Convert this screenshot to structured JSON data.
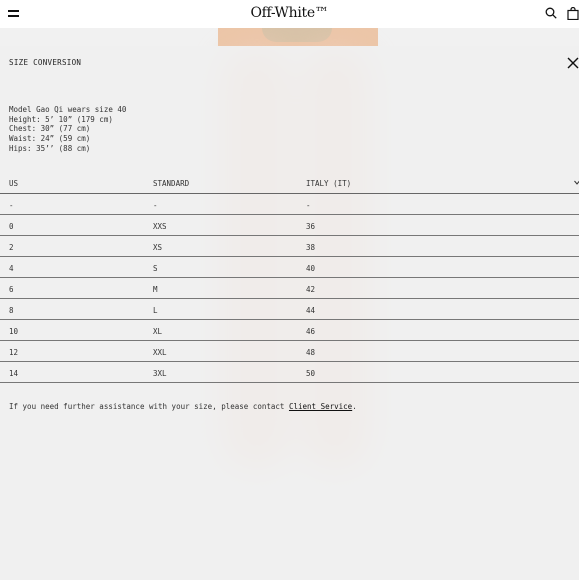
{
  "header": {
    "logo": "Off-White™",
    "menu_icon": "hamburger-menu-icon",
    "search_icon": "search-icon",
    "bag_icon": "shopping-bag-icon"
  },
  "panel": {
    "title": "SIZE CONVERSION",
    "close_icon": "close-icon",
    "model_info": [
      "Model Gao Qi wears size 40",
      "Height: 5’ 10” (179 cm)",
      "Chest: 30” (77 cm)",
      "Waist: 24” (59 cm)",
      "Hips: 35’’ (88 cm)"
    ],
    "table": {
      "headers": [
        "US",
        "STANDARD",
        "ITALY (IT)"
      ],
      "rows": [
        [
          "-",
          "-",
          "-"
        ],
        [
          "0",
          "XXS",
          "36"
        ],
        [
          "2",
          "XS",
          "38"
        ],
        [
          "4",
          "S",
          "40"
        ],
        [
          "6",
          "M",
          "42"
        ],
        [
          "8",
          "L",
          "44"
        ],
        [
          "10",
          "XL",
          "46"
        ],
        [
          "12",
          "XXL",
          "48"
        ],
        [
          "14",
          "3XL",
          "50"
        ]
      ]
    },
    "assistance_text": "If you need further assistance with your size, please contact ",
    "assistance_link": "Client Service",
    "assistance_end": "."
  }
}
